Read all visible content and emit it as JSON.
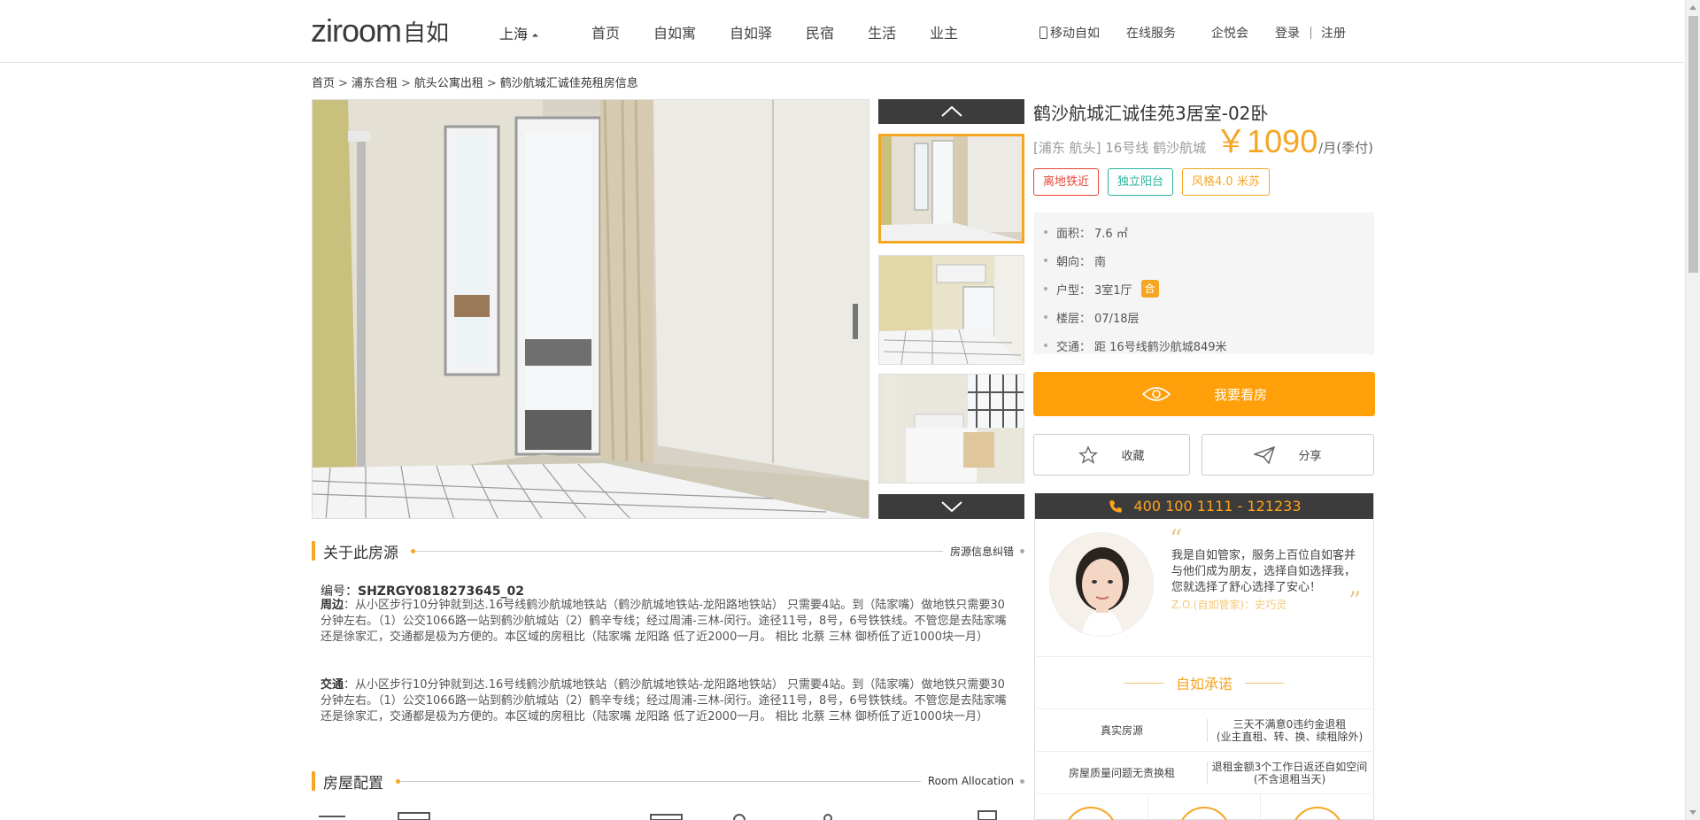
{
  "header": {
    "logo_latin": "ziroom",
    "logo_cn": "自如",
    "city": "上海",
    "nav": [
      "首页",
      "自如寓",
      "自如驿",
      "民宿",
      "生活",
      "业主"
    ],
    "mobile": "移动自如",
    "service": "在线服务",
    "club": "企悦会",
    "login": "登录",
    "register": "注册"
  },
  "breadcrumb": [
    "首页",
    "浦东合租",
    "航头公寓出租",
    "鹤沙航城汇诚佳苑租房信息"
  ],
  "listing": {
    "title": "鹤沙航城汇诚佳苑3居室-02卧",
    "location": "[浦东 航头] 16号线 鹤沙航城",
    "price_symbol": "￥",
    "price": "1090",
    "price_unit": "/月(季付)",
    "tags": [
      {
        "label": "离地铁近",
        "color": "#e8483a"
      },
      {
        "label": "独立阳台",
        "color": "#2bb59c"
      },
      {
        "label": "风格4.0 米苏",
        "color": "#f5a623"
      }
    ],
    "specs": [
      {
        "label": "面积：",
        "value": "7.6 ㎡"
      },
      {
        "label": "朝向：",
        "value": "南"
      },
      {
        "label": "户型：",
        "value": "3室1厅",
        "badge": "合"
      },
      {
        "label": "楼层：",
        "value": "07/18层"
      },
      {
        "label": "交通：",
        "value": "距 16号线鹤沙航城849米"
      }
    ],
    "view_button": "我要看房",
    "favorite_button": "收藏",
    "share_button": "分享"
  },
  "agent": {
    "hotline": "400 100 1111 - 121233",
    "intro": "我是自如管家，服务上百位自如客并与他们成为朋友，选择自如选择我，您就选择了舒心选择了安心！",
    "name": "Z.O.(自如管家)：史巧灵",
    "promise_title": "自如承诺",
    "promises": [
      {
        "left": "真实房源",
        "right1": "三天不满意0违约金退租",
        "right2": "(业主直租、转、换、续租除外)"
      },
      {
        "left": "房屋质量问题无责换租",
        "right1": "退租金额3个工作日返还自如空间",
        "right2": "(不含退租当天)"
      }
    ]
  },
  "about": {
    "heading": "关于此房源",
    "report_link": "房源信息纠错",
    "code_label": "编号：",
    "code": "SHZRGY0818273645_02",
    "surround_label": "周边",
    "surround": "：从小区步行10分钟就到达.16号线鹤沙航城地铁站（鹤沙航城地铁站-龙阳路地铁站） 只需要4站。到（陆家嘴）做地铁只需要30分钟左右。（1）公交1066路一站到鹤沙航城站（2）鹤辛专线；经过周浦-三林-闵行。途径11号，8号，6号铁铁线。不管您是去陆家嘴还是徐家汇，交通都是极为方便的。本区域的房租比（陆家嘴 龙阳路 低了近2000一月。 相比 北蔡 三林 御桥低了近1000块一月）",
    "traffic_label": "交通",
    "traffic": "：从小区步行10分钟就到达.16号线鹤沙航城地铁站（鹤沙航城地铁站-龙阳路地铁站） 只需要4站。到（陆家嘴）做地铁只需要30分钟左右。（1）公交1066路一站到鹤沙航城站（2）鹤辛专线；经过周浦-三林-闵行。途径11号，8号，6号铁铁线。不管您是去陆家嘴还是徐家汇，交通都是极为方便的。本区域的房租比（陆家嘴 龙阳路 低了近2000一月。 相比 北蔡 三林 御桥低了近1000块一月）"
  },
  "config": {
    "heading": "房屋配置",
    "link": "Room Allocation"
  },
  "colors": {
    "accent": "#f5a623",
    "button": "#ff9f0a",
    "dark_bar": "#3c3c3c"
  }
}
